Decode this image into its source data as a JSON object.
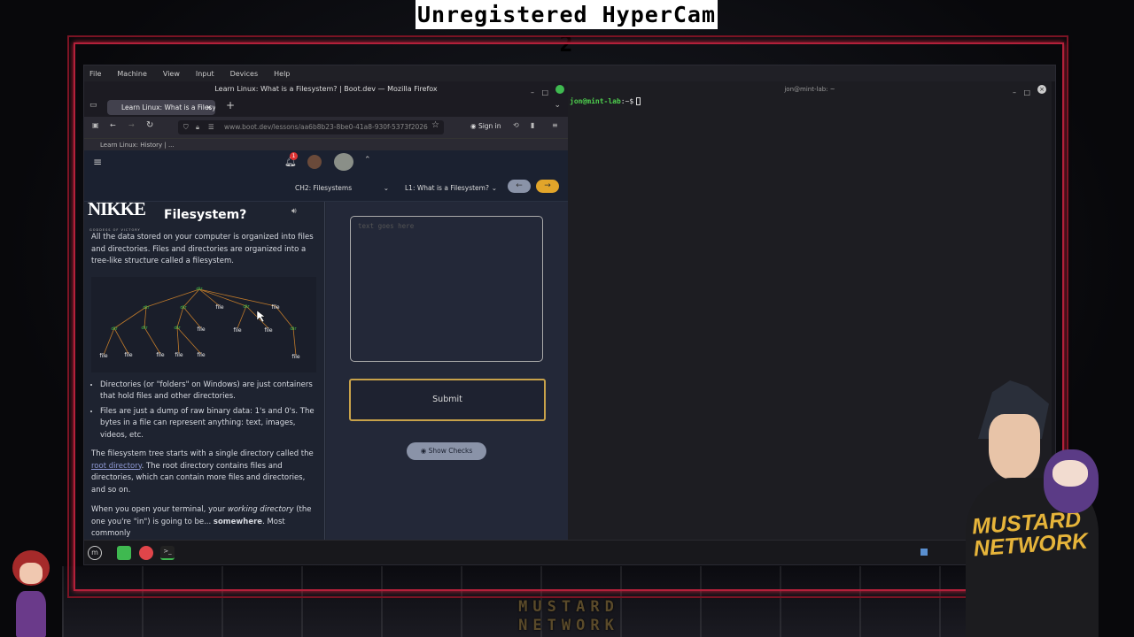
{
  "watermark": "Unregistered HyperCam 2",
  "brand_logo_text": "MUSTARD NETWORK",
  "vm_menu": [
    "File",
    "Machine",
    "View",
    "Input",
    "Devices",
    "Help"
  ],
  "firefox": {
    "window_title": "Learn Linux: What is a Filesystem? | Boot.dev — Mozilla Firefox",
    "tab_label": "Learn Linux: What is a Filesy",
    "url": "www.boot.dev/lessons/aa6b8b23-8be0-41a8-930f-5373f2026",
    "signin": "Sign in",
    "bookmark": "Learn Linux: History | ...",
    "chapter_select": "CH2: Filesystems",
    "lesson_select": "L1: What is a Filesystem?",
    "overlay_logo": "NIKKE",
    "overlay_logo_sub": "GODDESS OF VICTORY",
    "lesson_title": "Filesystem?",
    "intro": "All the data stored on your computer is organized into files and directories. Files and directories are organized into a tree-like structure called a filesystem.",
    "tree_dir_label": "dir",
    "tree_file_label": "file",
    "bullet1": "Directories (or \"folders\" on Windows) are just containers that hold files and other directories.",
    "bullet2": "Files are just a dump of raw binary data: 1's and 0's. The bytes in a file can represent anything: text, images, videos, etc.",
    "para_prefix": "The filesystem tree starts with a single directory called the ",
    "para_link": "root directory",
    "para_suffix": ". The root directory contains files and directories, which can contain more files and directories, and so on.",
    "para2_a": "When you open your terminal, your ",
    "para2_em": "working directory",
    "para2_b": " (the one you're \"in\") is going to be... ",
    "para2_strong": "somewhere",
    "para2_c": ". Most commonly",
    "editor_placeholder": "text goes here",
    "submit_label": "Submit",
    "show_checks_label": "Show Checks",
    "notification_count": "1"
  },
  "terminal": {
    "title": "jon@mint-lab: ~",
    "prompt_user": "jon@mint-lab",
    "prompt_rest": ":~$"
  },
  "colors": {
    "neon": "#c8213a",
    "accent": "#c8a24a",
    "prompt": "#4ed04e"
  }
}
